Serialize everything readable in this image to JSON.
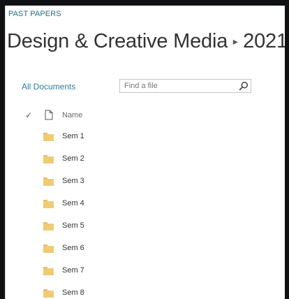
{
  "header": {
    "eyebrow": "PAST PAPERS",
    "title": {
      "site": "Design & Creative Media",
      "separator": "▸",
      "page": "2021"
    }
  },
  "nav": {
    "all_documents": "All Documents"
  },
  "search": {
    "placeholder": "Find a file"
  },
  "list": {
    "header": {
      "check_icon": "checkmark-icon",
      "type_icon": "document-icon",
      "name": "Name"
    },
    "items": [
      {
        "label": "Sem 1",
        "icon": "folder-icon"
      },
      {
        "label": "Sem 2",
        "icon": "folder-icon"
      },
      {
        "label": "Sem 3",
        "icon": "folder-icon"
      },
      {
        "label": "Sem 4",
        "icon": "folder-icon"
      },
      {
        "label": "Sem 5",
        "icon": "folder-icon"
      },
      {
        "label": "Sem 6",
        "icon": "folder-icon"
      },
      {
        "label": "Sem 7",
        "icon": "folder-icon"
      },
      {
        "label": "Sem 8",
        "icon": "folder-icon"
      }
    ]
  },
  "colors": {
    "background": "#7fb6cc",
    "frame": "#0f1113",
    "link": "#2b7ea8",
    "folder": "#f0cb74"
  }
}
